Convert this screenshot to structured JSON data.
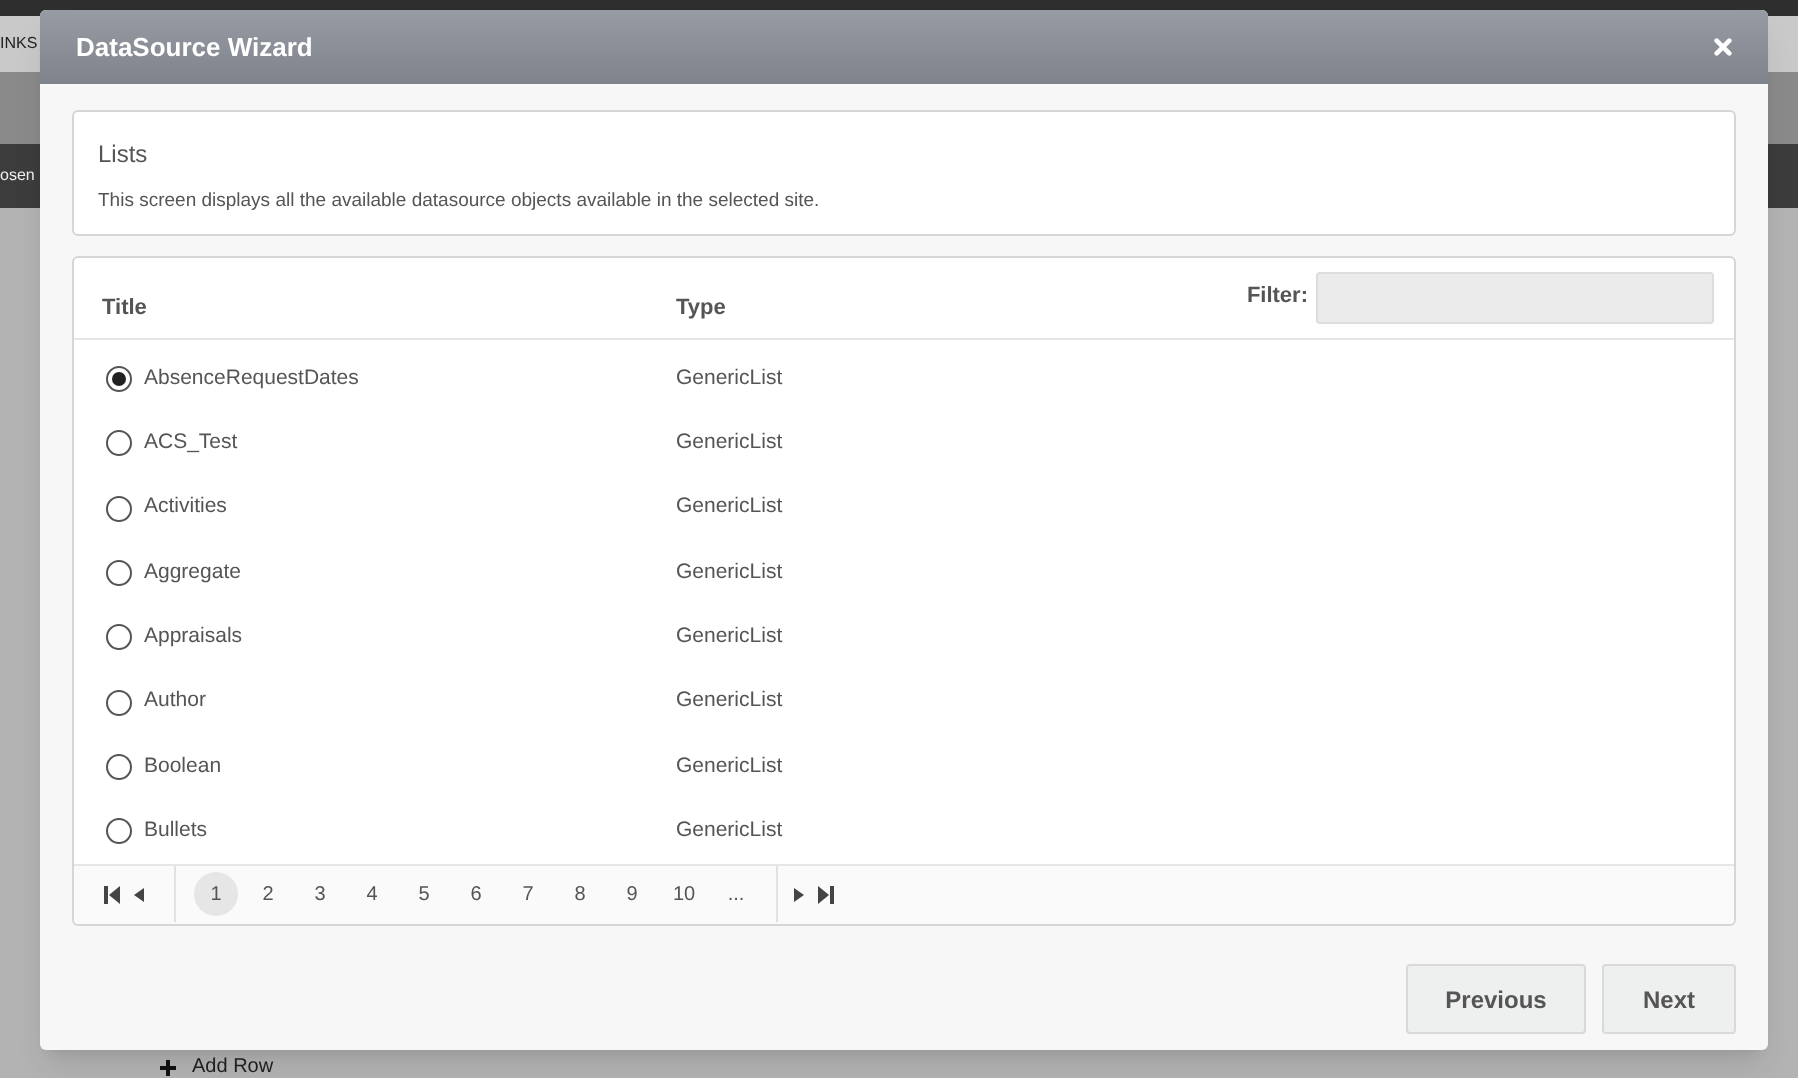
{
  "background": {
    "nav_text": "INKS",
    "tab_text": "osen",
    "add_row": "Add Row"
  },
  "dialog": {
    "title": "DataSource Wizard",
    "info": {
      "heading": "Lists",
      "description": "This screen displays all the available datasource objects available in the selected site."
    },
    "table": {
      "columns": [
        "Title",
        "Type"
      ],
      "filter_label": "Filter:",
      "rows": [
        {
          "title": "AbsenceRequestDates",
          "type": "GenericList",
          "selected": true
        },
        {
          "title": "ACS_Test",
          "type": "GenericList",
          "selected": false
        },
        {
          "title": "Activities",
          "type": "GenericList",
          "selected": false
        },
        {
          "title": "Aggregate",
          "type": "GenericList",
          "selected": false
        },
        {
          "title": "Appraisals",
          "type": "GenericList",
          "selected": false
        },
        {
          "title": "Author",
          "type": "GenericList",
          "selected": false
        },
        {
          "title": "Boolean",
          "type": "GenericList",
          "selected": false
        },
        {
          "title": "Bullets",
          "type": "GenericList",
          "selected": false
        }
      ],
      "pages": [
        {
          "label": "1",
          "selected": true
        },
        {
          "label": "2",
          "selected": false
        },
        {
          "label": "3",
          "selected": false
        },
        {
          "label": "4",
          "selected": false
        },
        {
          "label": "5",
          "selected": false
        },
        {
          "label": "6",
          "selected": false
        },
        {
          "label": "7",
          "selected": false
        },
        {
          "label": "8",
          "selected": false
        },
        {
          "label": "9",
          "selected": false
        },
        {
          "label": "10",
          "selected": false
        },
        {
          "label": "...",
          "selected": false
        }
      ]
    },
    "buttons": [
      "Previous",
      "Next"
    ]
  }
}
